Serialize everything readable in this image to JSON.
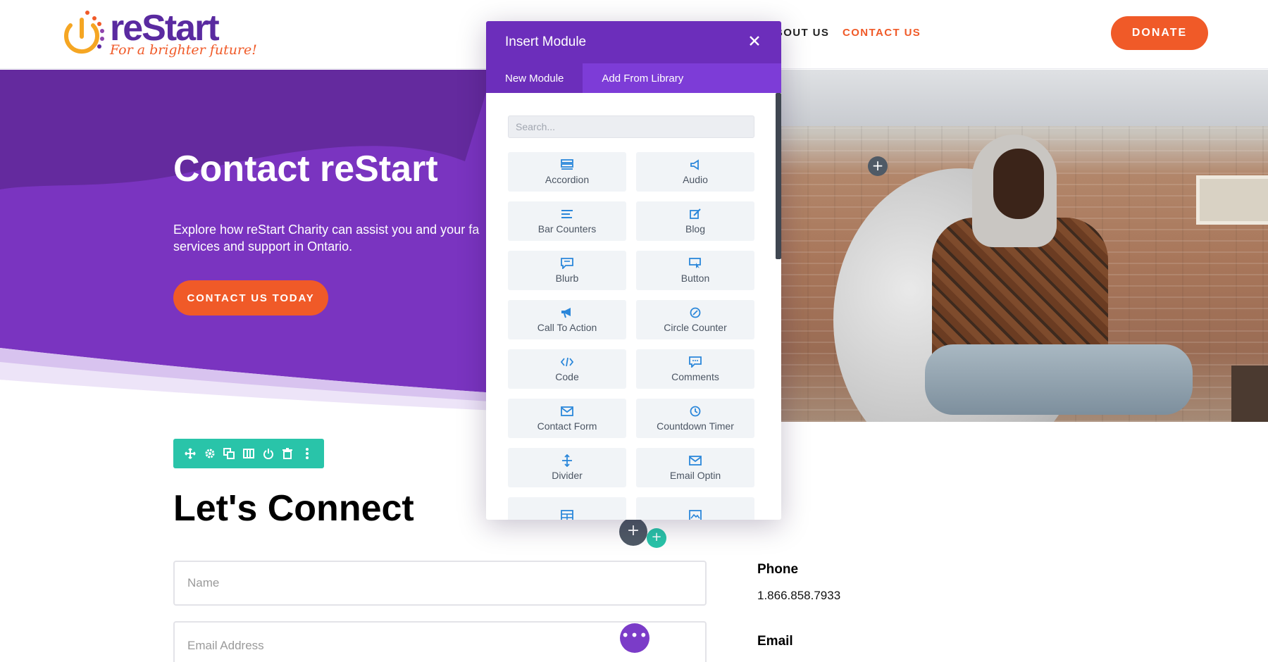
{
  "header": {
    "logo_name": "reStart",
    "logo_tagline": "For a brighter future!",
    "nav": {
      "about": "BOUT US",
      "contact": "CONTACT US"
    },
    "donate": "DONATE"
  },
  "hero": {
    "title": "Contact reStart",
    "subtitle_line1": "Explore how reStart Charity can assist you and your fa",
    "subtitle_line2": "services and support in Ontario.",
    "cta": "CONTACT US TODAY"
  },
  "connect": {
    "title": "Let's Connect",
    "name_placeholder": "Name",
    "email_placeholder": "Email Address",
    "phone_label": "Phone",
    "phone_value": "1.866.858.7933",
    "email_label": "Email"
  },
  "modal": {
    "title": "Insert Module",
    "tabs": [
      "New Module",
      "Add From Library"
    ],
    "search_placeholder": "Search...",
    "modules": [
      {
        "label": "Accordion",
        "icon": "accordion-icon"
      },
      {
        "label": "Audio",
        "icon": "audio-icon"
      },
      {
        "label": "Bar Counters",
        "icon": "bar-counters-icon"
      },
      {
        "label": "Blog",
        "icon": "blog-icon"
      },
      {
        "label": "Blurb",
        "icon": "blurb-icon"
      },
      {
        "label": "Button",
        "icon": "button-icon"
      },
      {
        "label": "Call To Action",
        "icon": "call-to-action-icon"
      },
      {
        "label": "Circle Counter",
        "icon": "circle-counter-icon"
      },
      {
        "label": "Code",
        "icon": "code-icon"
      },
      {
        "label": "Comments",
        "icon": "comments-icon"
      },
      {
        "label": "Contact Form",
        "icon": "contact-form-icon"
      },
      {
        "label": "Countdown Timer",
        "icon": "countdown-timer-icon"
      },
      {
        "label": "Divider",
        "icon": "divider-icon"
      },
      {
        "label": "Email Optin",
        "icon": "email-optin-icon"
      },
      {
        "label": "",
        "icon": "gallery-icon"
      },
      {
        "label": "",
        "icon": "image-icon"
      }
    ]
  },
  "colors": {
    "purple_dark": "#6c2ebb",
    "purple_light": "#7d3cd7",
    "orange": "#f05a28",
    "teal": "#29c4a9",
    "icon_blue": "#2b87da"
  }
}
